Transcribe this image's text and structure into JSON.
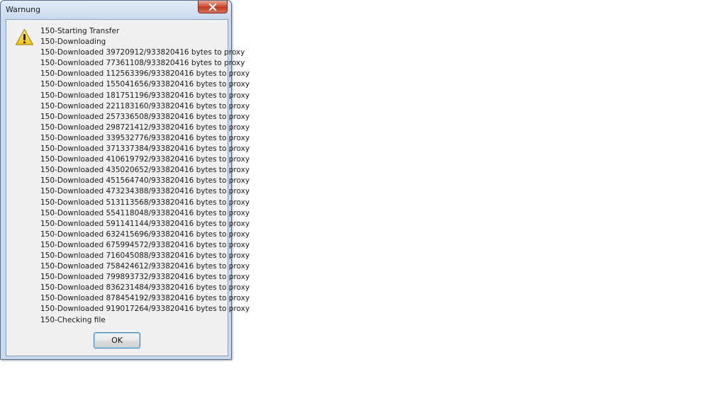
{
  "window": {
    "title": "Warnung"
  },
  "icons": {
    "warning": "warning-icon",
    "close": "close-icon"
  },
  "messages": [
    "150-Starting Transfer",
    "150-Downloading",
    "150-Downloaded 39720912/933820416 bytes to proxy",
    "150-Downloaded 77361108/933820416 bytes to proxy",
    "150-Downloaded 112563396/933820416 bytes to proxy",
    "150-Downloaded 155041656/933820416 bytes to proxy",
    "150-Downloaded 181751196/933820416 bytes to proxy",
    "150-Downloaded 221183160/933820416 bytes to proxy",
    "150-Downloaded 257336508/933820416 bytes to proxy",
    "150-Downloaded 298721412/933820416 bytes to proxy",
    "150-Downloaded 339532776/933820416 bytes to proxy",
    "150-Downloaded 371337384/933820416 bytes to proxy",
    "150-Downloaded 410619792/933820416 bytes to proxy",
    "150-Downloaded 435020652/933820416 bytes to proxy",
    "150-Downloaded 451564740/933820416 bytes to proxy",
    "150-Downloaded 473234388/933820416 bytes to proxy",
    "150-Downloaded 513113568/933820416 bytes to proxy",
    "150-Downloaded 554118048/933820416 bytes to proxy",
    "150-Downloaded 591141144/933820416 bytes to proxy",
    "150-Downloaded 632415696/933820416 bytes to proxy",
    "150-Downloaded 675994572/933820416 bytes to proxy",
    "150-Downloaded 716045088/933820416 bytes to proxy",
    "150-Downloaded 758424612/933820416 bytes to proxy",
    "150-Downloaded 799893732/933820416 bytes to proxy",
    "150-Downloaded 836231484/933820416 bytes to proxy",
    "150-Downloaded 878454192/933820416 bytes to proxy",
    "150-Downloaded 919017264/933820416 bytes to proxy",
    "150-Checking file"
  ],
  "buttons": {
    "ok_label": "OK"
  }
}
